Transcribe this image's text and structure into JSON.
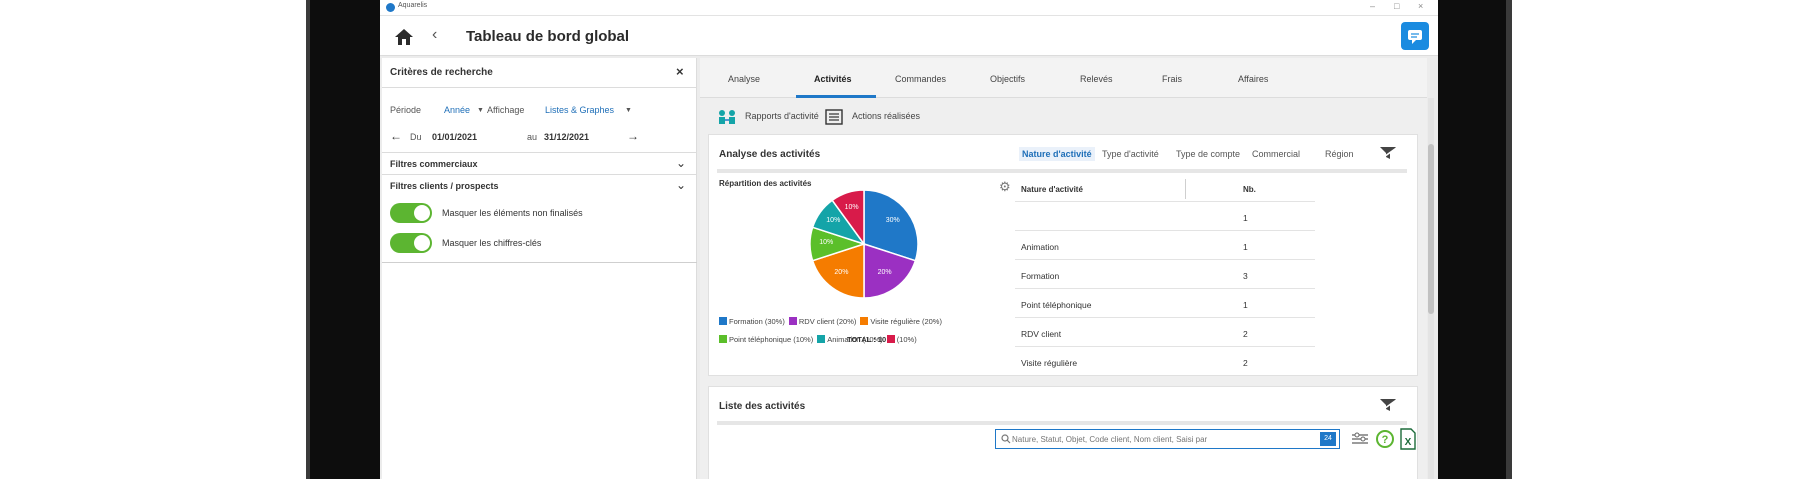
{
  "app": {
    "name": "Aquarelis",
    "title": "Tableau de bord global"
  },
  "colors": {
    "accent": "#1f78c8",
    "toggle_on": "#5cb531"
  },
  "left_panel": {
    "title": "Critères de recherche",
    "periode_label": "Période",
    "periode_value": "Année",
    "affichage_label": "Affichage",
    "affichage_value": "Listes & Graphes",
    "du_label": "Du",
    "du_date": "01/01/2021",
    "au_label": "au",
    "au_date": "31/12/2021",
    "sections": [
      "Filtres commerciaux",
      "Filtres clients / prospects"
    ],
    "toggles": [
      {
        "label": "Masquer les éléments non finalisés",
        "on": true
      },
      {
        "label": "Masquer les chiffres-clés",
        "on": true
      }
    ]
  },
  "tabs": [
    "Analyse",
    "Activités",
    "Commandes",
    "Objectifs",
    "Relevés",
    "Frais",
    "Affaires"
  ],
  "active_tab": "Activités",
  "subnav": [
    "Rapports d'activité",
    "Actions réalisées"
  ],
  "analysis": {
    "title": "Analyse des activités",
    "filters": [
      "Nature d'activité",
      "Type d'activité",
      "Type de compte",
      "Commercial",
      "Région"
    ],
    "active_filter": "Nature d'activité",
    "chart_title": "Répartition des activités",
    "total_label": "TOTAL : 10",
    "table_headers": [
      "Nature d'activité",
      "Nb."
    ],
    "table_rows": [
      {
        "name": "",
        "count": "1"
      },
      {
        "name": "Animation",
        "count": "1"
      },
      {
        "name": "Formation",
        "count": "3"
      },
      {
        "name": "Point téléphonique",
        "count": "1"
      },
      {
        "name": "RDV client",
        "count": "2"
      },
      {
        "name": "Visite régulière",
        "count": "2"
      }
    ]
  },
  "chart_data": {
    "type": "pie",
    "title": "Répartition des activités",
    "categories": [
      "Formation",
      "RDV client",
      "Visite régulière",
      "Point téléphonique",
      "Animation",
      ""
    ],
    "values": [
      30,
      20,
      20,
      10,
      10,
      10
    ],
    "slice_labels": [
      "30%",
      "20%",
      "20%",
      "10%",
      "10%",
      "10%"
    ],
    "legend_labels": [
      "Formation (30%)",
      "RDV client (20%)",
      "Visite régulière (20%)",
      "Point téléphonique (10%)",
      "Animation (10%)",
      "(10%)"
    ],
    "colors": [
      "#1f78c8",
      "#9b30c2",
      "#f57c00",
      "#5bbf2a",
      "#14a4a8",
      "#d81b4a"
    ],
    "total": "TOTAL : 10"
  },
  "list": {
    "title": "Liste des activités",
    "search_placeholder": "Nature, Statut, Objet, Code client, Nom client, Saisi par",
    "search_count": "24"
  }
}
